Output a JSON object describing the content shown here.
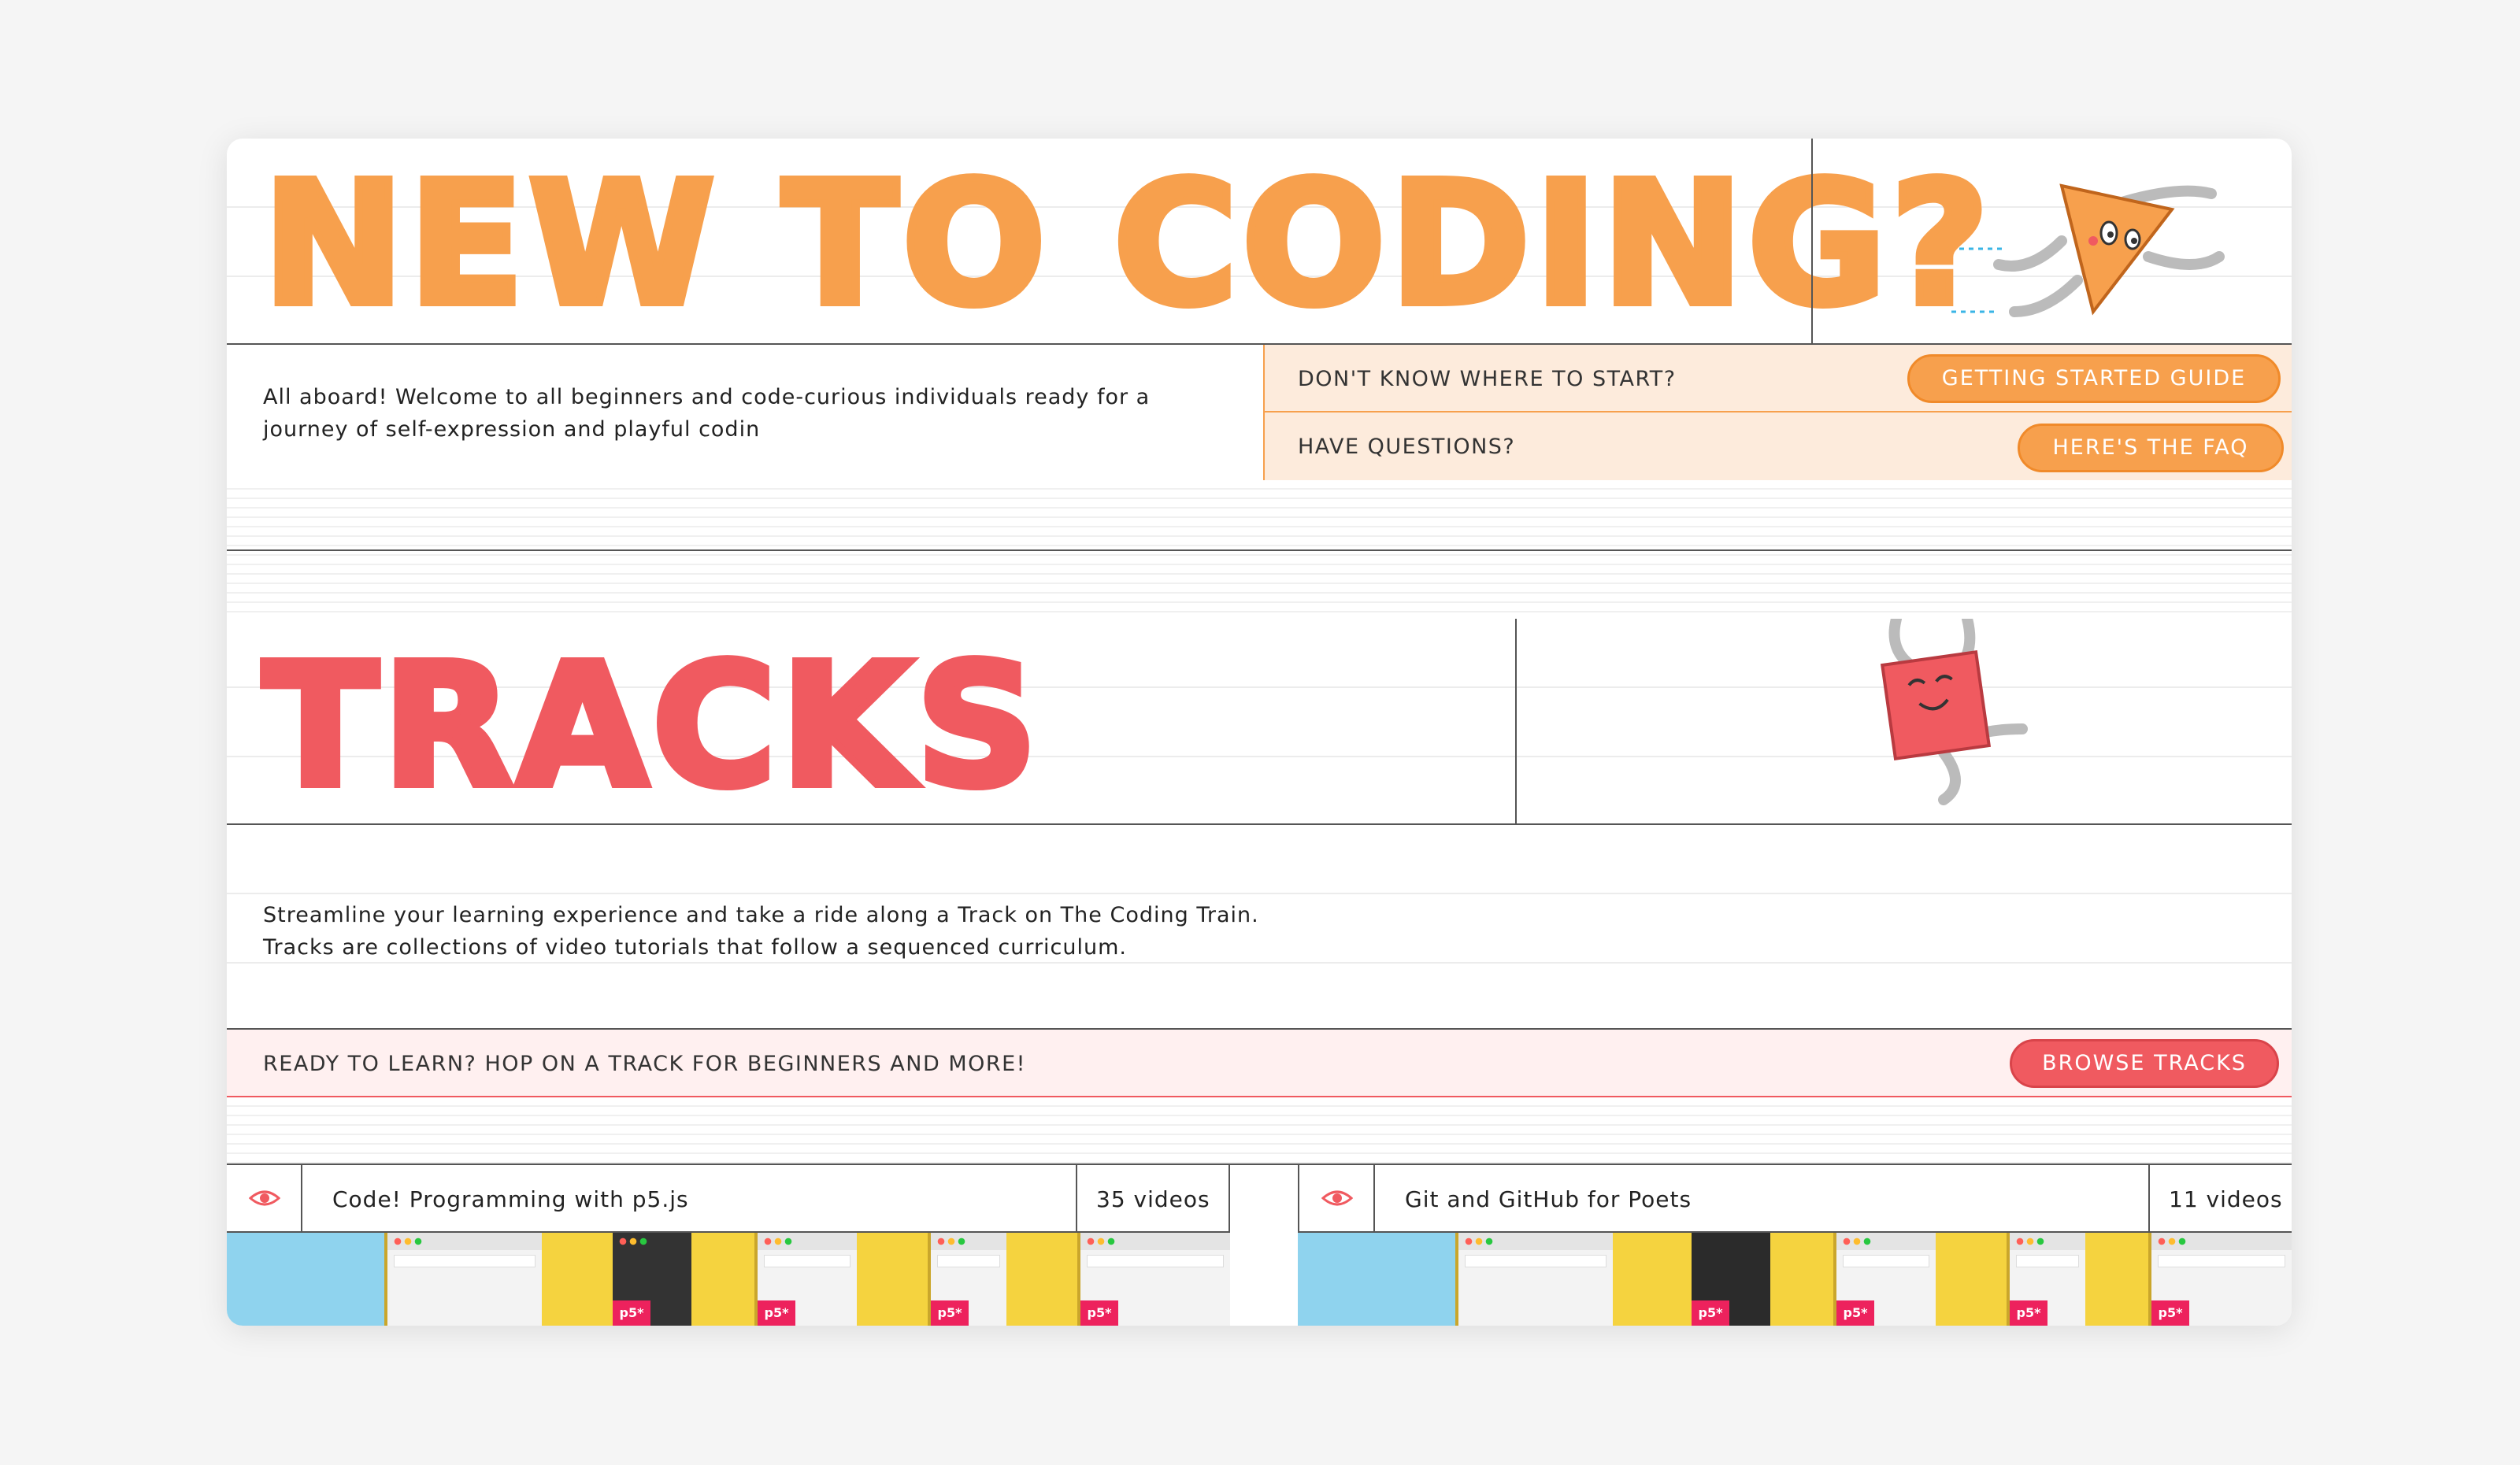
{
  "hero": {
    "title": "NEW TO CODING?"
  },
  "intro": {
    "text": "All aboard! Welcome to all beginners and code-curious individuals ready for a journey of self-expression and playful codin",
    "cta1_label": "DON'T KNOW WHERE TO START?",
    "cta1_button": "GETTING STARTED GUIDE",
    "cta2_label": "HAVE QUESTIONS?",
    "cta2_button": "HERE'S THE FAQ"
  },
  "tracks": {
    "title": "TRACKS",
    "desc_line1": "Streamline your learning experience and take a ride along a Track on The Coding Train.",
    "desc_line2": "Tracks are collections of video tutorials that follow a sequenced curriculum.",
    "ready_label": "READY TO LEARN? HOP ON A TRACK FOR BEGINNERS AND MORE!",
    "browse_button": "BROWSE TRACKS"
  },
  "track_cards": [
    {
      "name": "Code! Programming with p5.js",
      "count": "35 videos"
    },
    {
      "name": "Git and GitHub for Poets",
      "count": "11 videos"
    }
  ],
  "colors": {
    "orange": "#f7a04d",
    "red": "#f05a60",
    "peach": "#fdebdc",
    "pink": "#fff0f0"
  },
  "icons": {
    "eye": "eye-icon",
    "mascot_triangle": "triangle-mascot-icon",
    "mascot_square": "square-mascot-icon"
  },
  "p5_badge": "p5*"
}
